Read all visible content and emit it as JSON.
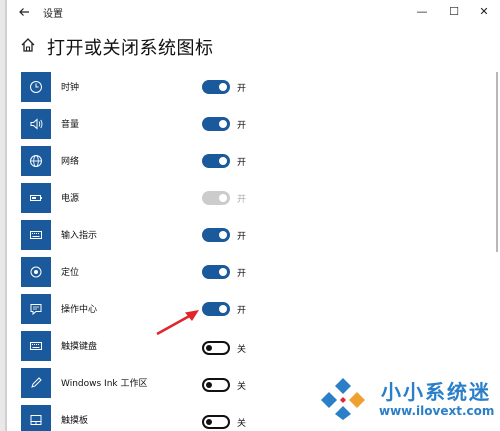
{
  "window": {
    "title": "设置",
    "controls": {
      "minimize": "—",
      "maximize": "☐",
      "close": "✕"
    }
  },
  "page": {
    "title": "打开或关闭系统图标"
  },
  "items": [
    {
      "label": "时钟",
      "icon": "clock-icon",
      "state": "on",
      "state_label": "开"
    },
    {
      "label": "音量",
      "icon": "volume-icon",
      "state": "on",
      "state_label": "开"
    },
    {
      "label": "网络",
      "icon": "globe-icon",
      "state": "on",
      "state_label": "开"
    },
    {
      "label": "电源",
      "icon": "battery-icon",
      "state": "disabled",
      "state_label": "开"
    },
    {
      "label": "输入指示",
      "icon": "keyboard-icon",
      "state": "on",
      "state_label": "开"
    },
    {
      "label": "定位",
      "icon": "location-icon",
      "state": "on",
      "state_label": "开"
    },
    {
      "label": "操作中心",
      "icon": "action-center-icon",
      "state": "on",
      "state_label": "开"
    },
    {
      "label": "触摸键盘",
      "icon": "keyboard-icon",
      "state": "off",
      "state_label": "关"
    },
    {
      "label": "Windows Ink 工作区",
      "icon": "pen-icon",
      "state": "off",
      "state_label": "关"
    },
    {
      "label": "触摸板",
      "icon": "touchpad-icon",
      "state": "off",
      "state_label": "关"
    }
  ],
  "colors": {
    "accent": "#1a5a9c",
    "annotation_arrow": "#e0252c",
    "watermark": "#2a7fc8"
  },
  "watermark": {
    "brand": "小小系统迷",
    "url": "www.ilovext.com"
  }
}
